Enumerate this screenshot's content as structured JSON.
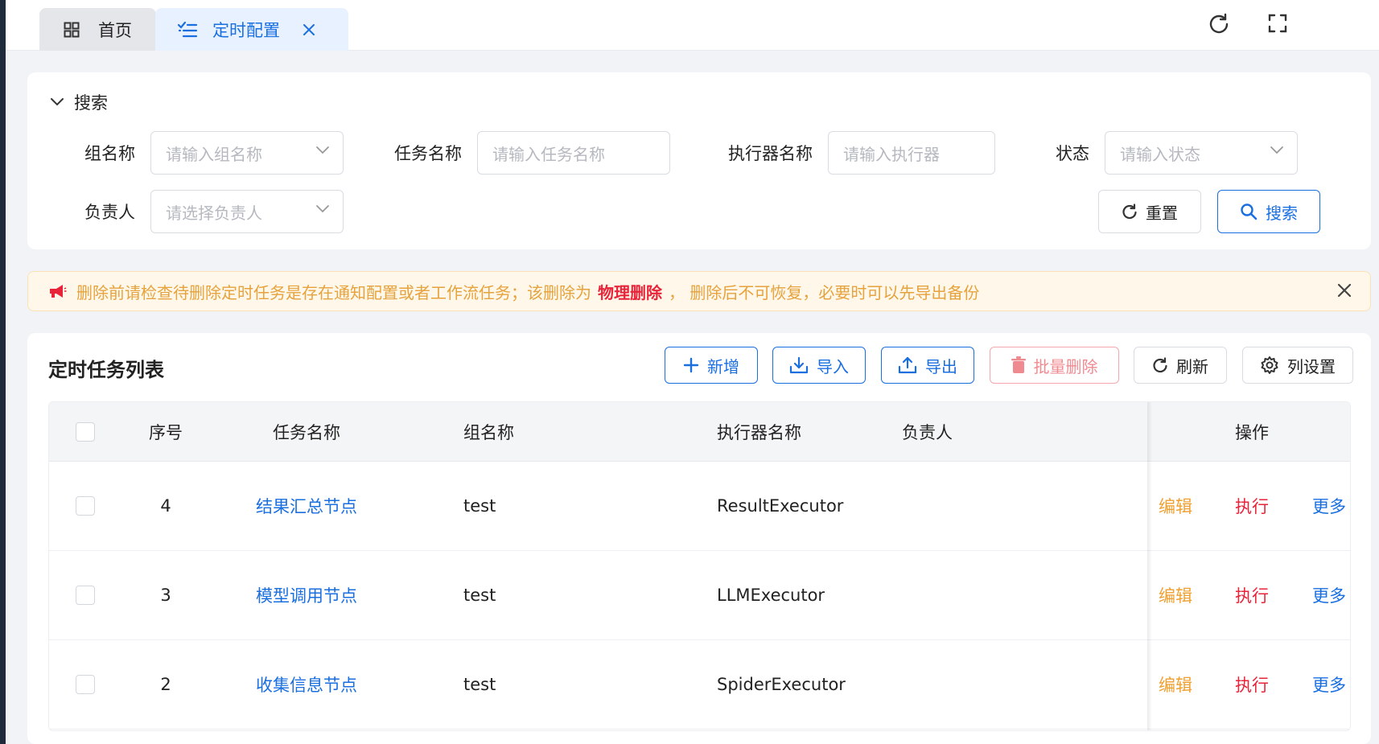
{
  "tabs": {
    "home_label": "首页",
    "active_label": "定时配置"
  },
  "search": {
    "toggle_label": "搜索",
    "fields": {
      "group_label": "组名称",
      "group_placeholder": "请输入组名称",
      "task_label": "任务名称",
      "task_placeholder": "请输入任务名称",
      "executor_label": "执行器名称",
      "executor_placeholder": "请输入执行器",
      "status_label": "状态",
      "status_placeholder": "请输入状态",
      "owner_label": "负责人",
      "owner_placeholder": "请选择负责人"
    },
    "reset_label": "重置",
    "search_label": "搜索"
  },
  "alert": {
    "text_before": "删除前请检查待删除定时任务是存在通知配置或者工作流任务；该删除为",
    "strong": "物理删除",
    "text_after": "， 删除后不可恢复，必要时可以先导出备份"
  },
  "list": {
    "title": "定时任务列表",
    "toolbar": {
      "add": "新增",
      "import": "导入",
      "export": "导出",
      "batch_delete": "批量删除",
      "refresh": "刷新",
      "column_settings": "列设置"
    },
    "columns": {
      "index": "序号",
      "task_name": "任务名称",
      "group_name": "组名称",
      "executor": "执行器名称",
      "owner": "负责人",
      "actions": "操作"
    },
    "rows": [
      {
        "index": "4",
        "task_name": "结果汇总节点",
        "group_name": "test",
        "executor": "ResultExecutor",
        "owner": "",
        "edit": "编辑",
        "run": "执行",
        "more": "更多"
      },
      {
        "index": "3",
        "task_name": "模型调用节点",
        "group_name": "test",
        "executor": "LLMExecutor",
        "owner": "",
        "edit": "编辑",
        "run": "执行",
        "more": "更多"
      },
      {
        "index": "2",
        "task_name": "收集信息节点",
        "group_name": "test",
        "executor": "SpiderExecutor",
        "owner": "",
        "edit": "编辑",
        "run": "执行",
        "more": "更多"
      }
    ]
  },
  "colors": {
    "primary": "#1a6fe0",
    "danger": "#e8243a",
    "warning": "#f0a030",
    "alert_bg": "#fff8ea"
  }
}
